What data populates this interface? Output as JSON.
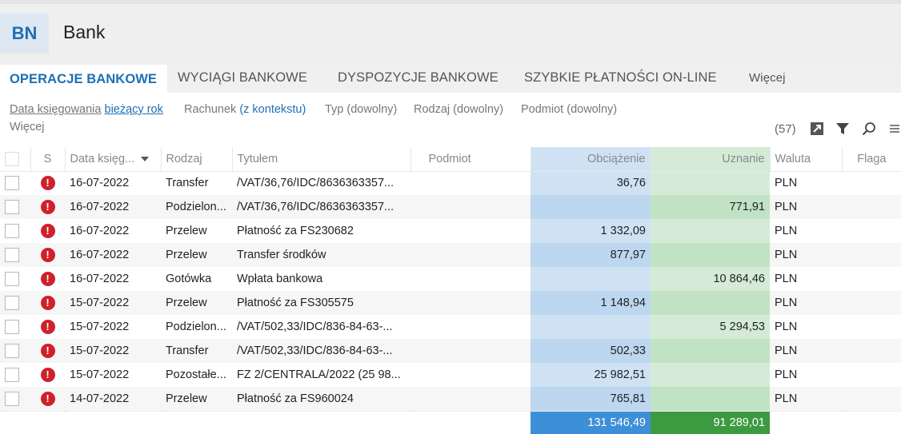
{
  "app": {
    "badge": "BN",
    "title": "Bank"
  },
  "tabs": [
    {
      "label": "OPERACJE BANKOWE",
      "active": true
    },
    {
      "label": "WYCIĄGI BANKOWE",
      "active": false
    },
    {
      "label": "DYSPOZYCJE BANKOWE",
      "active": false
    },
    {
      "label": "SZYBKIE PŁATNOŚCI ON-LINE",
      "active": false
    },
    {
      "label": "Więcej",
      "active": false
    }
  ],
  "filters": [
    {
      "label": "Data księgowania",
      "value": "bieżący rok"
    },
    {
      "label": "Rachunek",
      "value": "(z kontekstu)"
    },
    {
      "label": "Typ",
      "value": "(dowolny)"
    },
    {
      "label": "Rodzaj",
      "value": "(dowolny)"
    },
    {
      "label": "Podmiot",
      "value": "(dowolny)"
    }
  ],
  "more_filters": "Więcej",
  "toolbar": {
    "count": "(57)",
    "icons": [
      "export-icon",
      "filter-icon",
      "search-icon",
      "menu-icon"
    ]
  },
  "columns": {
    "s": "S",
    "date": "Data księg...",
    "kind": "Rodzaj",
    "title": "Tytułem",
    "subject": "Podmiot",
    "debit": "Obciążenie",
    "credit": "Uznanie",
    "currency": "Waluta",
    "flag": "Flaga"
  },
  "rows": [
    {
      "date": "16-07-2022",
      "kind": "Transfer",
      "title": "/VAT/36,76/IDC/8636363357...",
      "subject": "",
      "debit": "36,76",
      "credit": "",
      "currency": "PLN",
      "flag": ""
    },
    {
      "date": "16-07-2022",
      "kind": "Podzielon...",
      "title": "/VAT/36,76/IDC/8636363357...",
      "subject": "",
      "debit": "",
      "credit": "771,91",
      "currency": "PLN",
      "flag": ""
    },
    {
      "date": "16-07-2022",
      "kind": "Przelew",
      "title": "Płatność za FS230682",
      "subject": "",
      "debit": "1 332,09",
      "credit": "",
      "currency": "PLN",
      "flag": ""
    },
    {
      "date": "16-07-2022",
      "kind": "Przelew",
      "title": "Transfer środków",
      "subject": "",
      "debit": "877,97",
      "credit": "",
      "currency": "PLN",
      "flag": ""
    },
    {
      "date": "16-07-2022",
      "kind": "Gotówka",
      "title": "Wpłata bankowa",
      "subject": "",
      "debit": "",
      "credit": "10 864,46",
      "currency": "PLN",
      "flag": ""
    },
    {
      "date": "15-07-2022",
      "kind": "Przelew",
      "title": "Płatność za FS305575",
      "subject": "",
      "debit": "1 148,94",
      "credit": "",
      "currency": "PLN",
      "flag": ""
    },
    {
      "date": "15-07-2022",
      "kind": "Podzielon...",
      "title": "/VAT/502,33/IDC/836-84-63-...",
      "subject": "",
      "debit": "",
      "credit": "5 294,53",
      "currency": "PLN",
      "flag": ""
    },
    {
      "date": "15-07-2022",
      "kind": "Transfer",
      "title": "/VAT/502,33/IDC/836-84-63-...",
      "subject": "",
      "debit": "502,33",
      "credit": "",
      "currency": "PLN",
      "flag": ""
    },
    {
      "date": "15-07-2022",
      "kind": "Pozostałe...",
      "title": "FZ 2/CENTRALA/2022 (25 98...",
      "subject": "",
      "debit": "25 982,51",
      "credit": "",
      "currency": "PLN",
      "flag": ""
    },
    {
      "date": "14-07-2022",
      "kind": "Przelew",
      "title": "Płatność za FS960024",
      "subject": "",
      "debit": "765,81",
      "credit": "",
      "currency": "PLN",
      "flag": ""
    }
  ],
  "totals": {
    "debit": "131 546,49",
    "credit": "91 289,01"
  },
  "status_icon": "error-icon",
  "colors": {
    "accent": "#1f6fb5",
    "debit_total": "#3d8fd8",
    "credit_total": "#3c9a40",
    "error": "#d0202c"
  }
}
